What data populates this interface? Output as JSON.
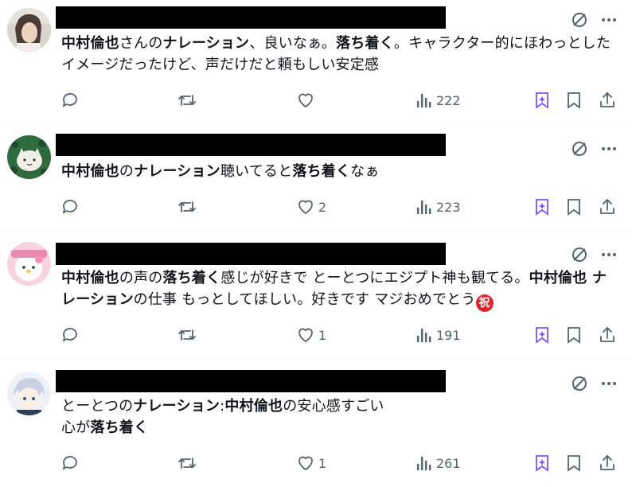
{
  "posts": [
    {
      "segments": [
        {
          "t": "中村倫也",
          "b": true
        },
        {
          "t": "さんの",
          "b": false
        },
        {
          "t": "ナレーション",
          "b": true
        },
        {
          "t": "、良いなぁ。",
          "b": false
        },
        {
          "t": "落ち着く",
          "b": true
        },
        {
          "t": "。キャラクター的にほわっとしたイメージだったけど、声だけだと頼もしい安定感",
          "b": false
        }
      ],
      "reply_count": "",
      "repost_count": "",
      "like_count": "",
      "views": "222"
    },
    {
      "segments": [
        {
          "t": "中村倫也",
          "b": true
        },
        {
          "t": "の",
          "b": false
        },
        {
          "t": "ナレーション",
          "b": true
        },
        {
          "t": "聴いてると",
          "b": false
        },
        {
          "t": "落ち着く",
          "b": true
        },
        {
          "t": "なぁ",
          "b": false
        }
      ],
      "reply_count": "",
      "repost_count": "",
      "like_count": "2",
      "views": "223"
    },
    {
      "segments": [
        {
          "t": "中村倫也",
          "b": true
        },
        {
          "t": "の声の",
          "b": false
        },
        {
          "t": "落ち着く",
          "b": true
        },
        {
          "t": "感じが好きで とーとつにエジプト神も観てる。",
          "b": false
        },
        {
          "t": "中村倫也 ナレーション",
          "b": true
        },
        {
          "t": "の仕事 もっとしてほしい。好きです マジおめでとう",
          "b": false
        }
      ],
      "emoji": "祝",
      "reply_count": "",
      "repost_count": "",
      "like_count": "1",
      "views": "191"
    },
    {
      "segments": [
        {
          "t": "とーとつの",
          "b": false
        },
        {
          "t": "ナレーション",
          "b": true
        },
        {
          "t": ":",
          "b": false
        },
        {
          "t": "中村倫也",
          "b": true
        },
        {
          "t": "の安心感すごい\n心が",
          "b": false
        },
        {
          "t": "落ち着く",
          "b": true
        }
      ],
      "reply_count": "",
      "repost_count": "",
      "like_count": "1",
      "views": "261"
    }
  ],
  "colors": {
    "icon_gray": "#536471",
    "grok_purple": "#7856ff",
    "text": "#0f1419",
    "divider": "#eff3f4"
  },
  "icons": [
    "grok-icon",
    "more-icon",
    "reply-icon",
    "repost-icon",
    "like-icon",
    "views-icon",
    "bookmark-icon",
    "share-icon"
  ]
}
